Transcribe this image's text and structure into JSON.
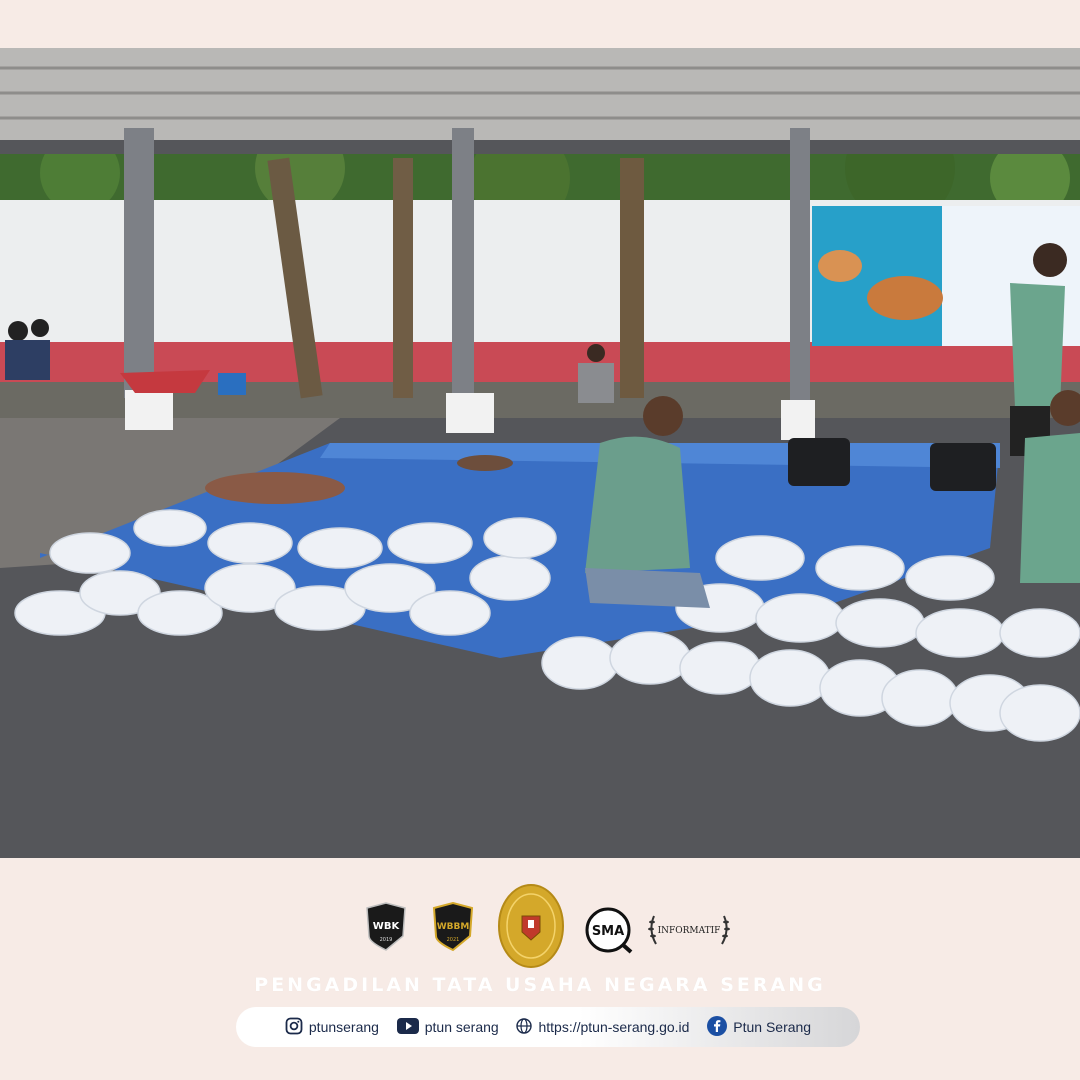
{
  "footer": {
    "institution_name": "PENGADILAN TATA USAHA NEGARA SERANG",
    "logos": [
      {
        "name": "wbk-badge",
        "text": "WBK",
        "sub": "2019"
      },
      {
        "name": "wbbm-badge",
        "text": "WBBM",
        "sub": "2021"
      },
      {
        "name": "gold-seal",
        "text": ""
      },
      {
        "name": "sma-logo",
        "text": "SMA"
      },
      {
        "name": "informatif-award",
        "text": "INFORMATIF"
      }
    ],
    "social": {
      "instagram": "ptunserang",
      "youtube": "ptun serang",
      "website": "https://ptun-serang.go.id",
      "facebook": "Ptun Serang"
    }
  },
  "icons": [
    "instagram-icon",
    "youtube-icon",
    "globe-icon",
    "facebook-icon"
  ],
  "colors": {
    "background": "#f7ebe6",
    "tarp": "#3a6fc4",
    "bags": "#eef1f6",
    "wall_stripe": "#c94a55",
    "gold": "#d4a82a"
  }
}
